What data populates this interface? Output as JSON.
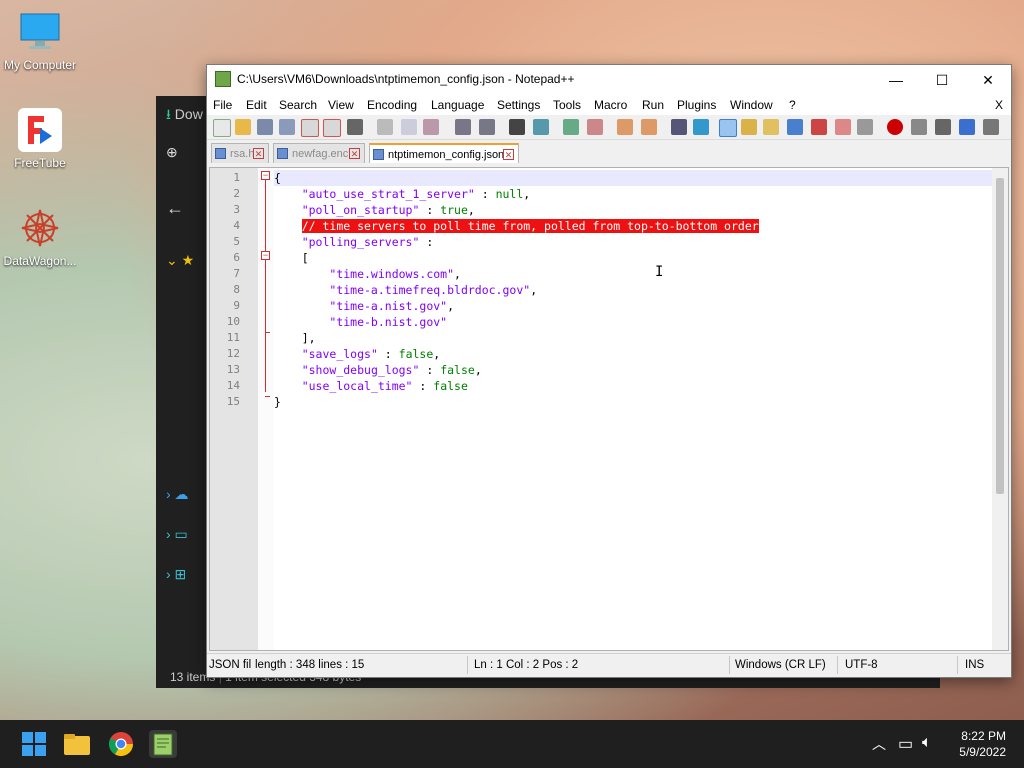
{
  "desktop": {
    "icons": [
      {
        "label": "My Computer",
        "icon": "monitor-icon"
      },
      {
        "label": "FreeTube",
        "icon": "freetube-icon"
      },
      {
        "label": "DataWagon...",
        "icon": "datawagon-icon"
      }
    ]
  },
  "explorer": {
    "tab_fragment": "Dow",
    "status_items": "13 items",
    "status_selected": "1 item selected  348 bytes"
  },
  "window": {
    "title": "C:\\Users\\VM6\\Downloads\\ntptimemon_config.json - Notepad++",
    "minimize": "—",
    "maximize": "☐",
    "close": "✕",
    "menu_close": "X"
  },
  "menu": {
    "items": [
      "File",
      "Edit",
      "Search",
      "View",
      "Encoding",
      "Language",
      "Settings",
      "Tools",
      "Macro",
      "Run",
      "Plugins",
      "Window",
      "?"
    ]
  },
  "tabs": [
    {
      "label": "rsa.h",
      "active": false
    },
    {
      "label": "newfag.enc",
      "active": false
    },
    {
      "label": "ntptimemon_config.json",
      "active": true
    }
  ],
  "editor": {
    "line_numbers": [
      "1",
      "2",
      "3",
      "4",
      "5",
      "6",
      "7",
      "8",
      "9",
      "10",
      "11",
      "12",
      "13",
      "14",
      "15"
    ],
    "lines": [
      [
        {
          "t": "{",
          "c": "p"
        }
      ],
      [
        {
          "t": "    ",
          "c": "p"
        },
        {
          "t": "\"auto_use_strat_1_server\"",
          "c": "s"
        },
        {
          "t": " : ",
          "c": "p"
        },
        {
          "t": "null",
          "c": "k"
        },
        {
          "t": ",",
          "c": "p"
        }
      ],
      [
        {
          "t": "    ",
          "c": "p"
        },
        {
          "t": "\"poll_on_startup\"",
          "c": "s"
        },
        {
          "t": " : ",
          "c": "p"
        },
        {
          "t": "true",
          "c": "k"
        },
        {
          "t": ",",
          "c": "p"
        }
      ],
      [
        {
          "t": "    ",
          "c": "p"
        },
        {
          "t": "// time servers to poll time from, polled from top-to-bottom order",
          "c": "cmt"
        }
      ],
      [
        {
          "t": "    ",
          "c": "p"
        },
        {
          "t": "\"polling_servers\"",
          "c": "s"
        },
        {
          "t": " :",
          "c": "p"
        }
      ],
      [
        {
          "t": "    [",
          "c": "p"
        }
      ],
      [
        {
          "t": "        ",
          "c": "p"
        },
        {
          "t": "\"time.windows.com\"",
          "c": "s"
        },
        {
          "t": ",",
          "c": "p"
        }
      ],
      [
        {
          "t": "        ",
          "c": "p"
        },
        {
          "t": "\"time-a.timefreq.bldrdoc.gov\"",
          "c": "s"
        },
        {
          "t": ",",
          "c": "p"
        }
      ],
      [
        {
          "t": "        ",
          "c": "p"
        },
        {
          "t": "\"time-a.nist.gov\"",
          "c": "s"
        },
        {
          "t": ",",
          "c": "p"
        }
      ],
      [
        {
          "t": "        ",
          "c": "p"
        },
        {
          "t": "\"time-b.nist.gov\"",
          "c": "s"
        }
      ],
      [
        {
          "t": "    ],",
          "c": "p"
        }
      ],
      [
        {
          "t": "    ",
          "c": "p"
        },
        {
          "t": "\"save_logs\"",
          "c": "s"
        },
        {
          "t": " : ",
          "c": "p"
        },
        {
          "t": "false",
          "c": "k"
        },
        {
          "t": ",",
          "c": "p"
        }
      ],
      [
        {
          "t": "    ",
          "c": "p"
        },
        {
          "t": "\"show_debug_logs\"",
          "c": "s"
        },
        {
          "t": " : ",
          "c": "p"
        },
        {
          "t": "false",
          "c": "k"
        },
        {
          "t": ",",
          "c": "p"
        }
      ],
      [
        {
          "t": "    ",
          "c": "p"
        },
        {
          "t": "\"use_local_time\"",
          "c": "s"
        },
        {
          "t": " : ",
          "c": "p"
        },
        {
          "t": "false",
          "c": "k"
        }
      ],
      [
        {
          "t": "}",
          "c": "p"
        }
      ]
    ]
  },
  "status": {
    "file_type": "JSON fil",
    "length_lines": "length : 348    lines : 15",
    "position": "Ln : 1    Col : 2    Pos : 2",
    "eol": "Windows (CR LF)",
    "encoding": "UTF-8",
    "mode": "INS"
  },
  "taskbar": {
    "time": "8:22 PM",
    "date": "5/9/2022",
    "tray_chevron": "︿"
  },
  "colors": {
    "key_string": "#8000ff",
    "keyword": "#008000",
    "comment_highlight": "#e11111",
    "active_tab_accent": "#f0a030"
  }
}
